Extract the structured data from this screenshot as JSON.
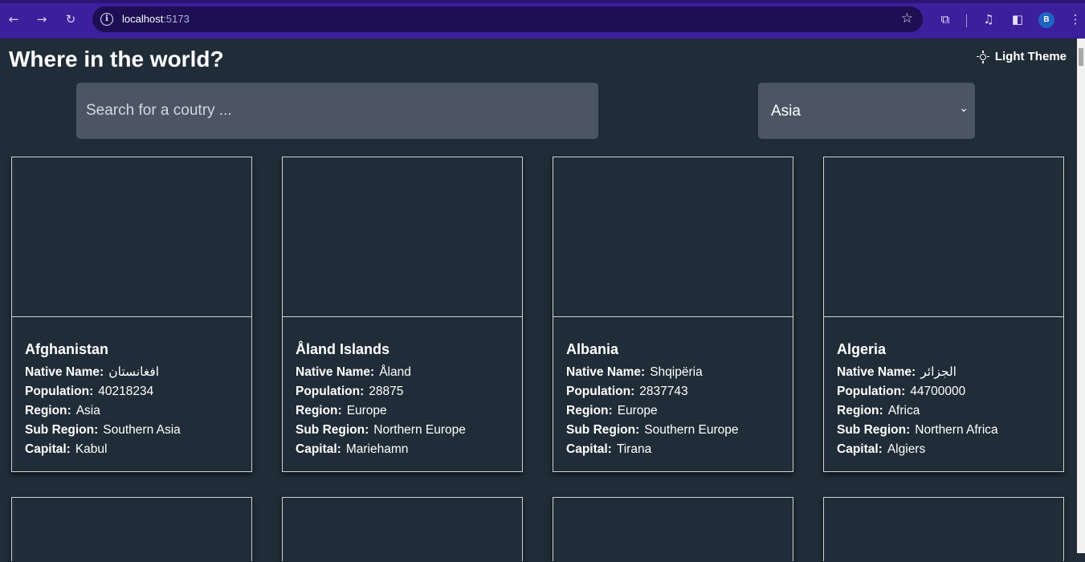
{
  "browser": {
    "url_host": "localhost",
    "url_port": ":5173",
    "avatar_letter": "B"
  },
  "header": {
    "title": "Where in the world?",
    "theme_toggle_label": "Light Theme"
  },
  "search": {
    "placeholder": "Search for a coutry ..."
  },
  "filter": {
    "selected": "Asia"
  },
  "labels": {
    "native_name": "Native Name:",
    "population": "Population:",
    "region": "Region:",
    "sub_region": "Sub Region:",
    "capital": "Capital:"
  },
  "countries": [
    {
      "name": "Afghanistan",
      "native_name": "افغانستان",
      "population": "40218234",
      "region": "Asia",
      "sub_region": "Southern Asia",
      "capital": "Kabul"
    },
    {
      "name": "Åland Islands",
      "native_name": "Åland",
      "population": "28875",
      "region": "Europe",
      "sub_region": "Northern Europe",
      "capital": "Mariehamn"
    },
    {
      "name": "Albania",
      "native_name": "Shqipëria",
      "population": "2837743",
      "region": "Europe",
      "sub_region": "Southern Europe",
      "capital": "Tirana"
    },
    {
      "name": "Algeria",
      "native_name": "الجزائر",
      "population": "44700000",
      "region": "Africa",
      "sub_region": "Northern Africa",
      "capital": "Algiers"
    }
  ]
}
